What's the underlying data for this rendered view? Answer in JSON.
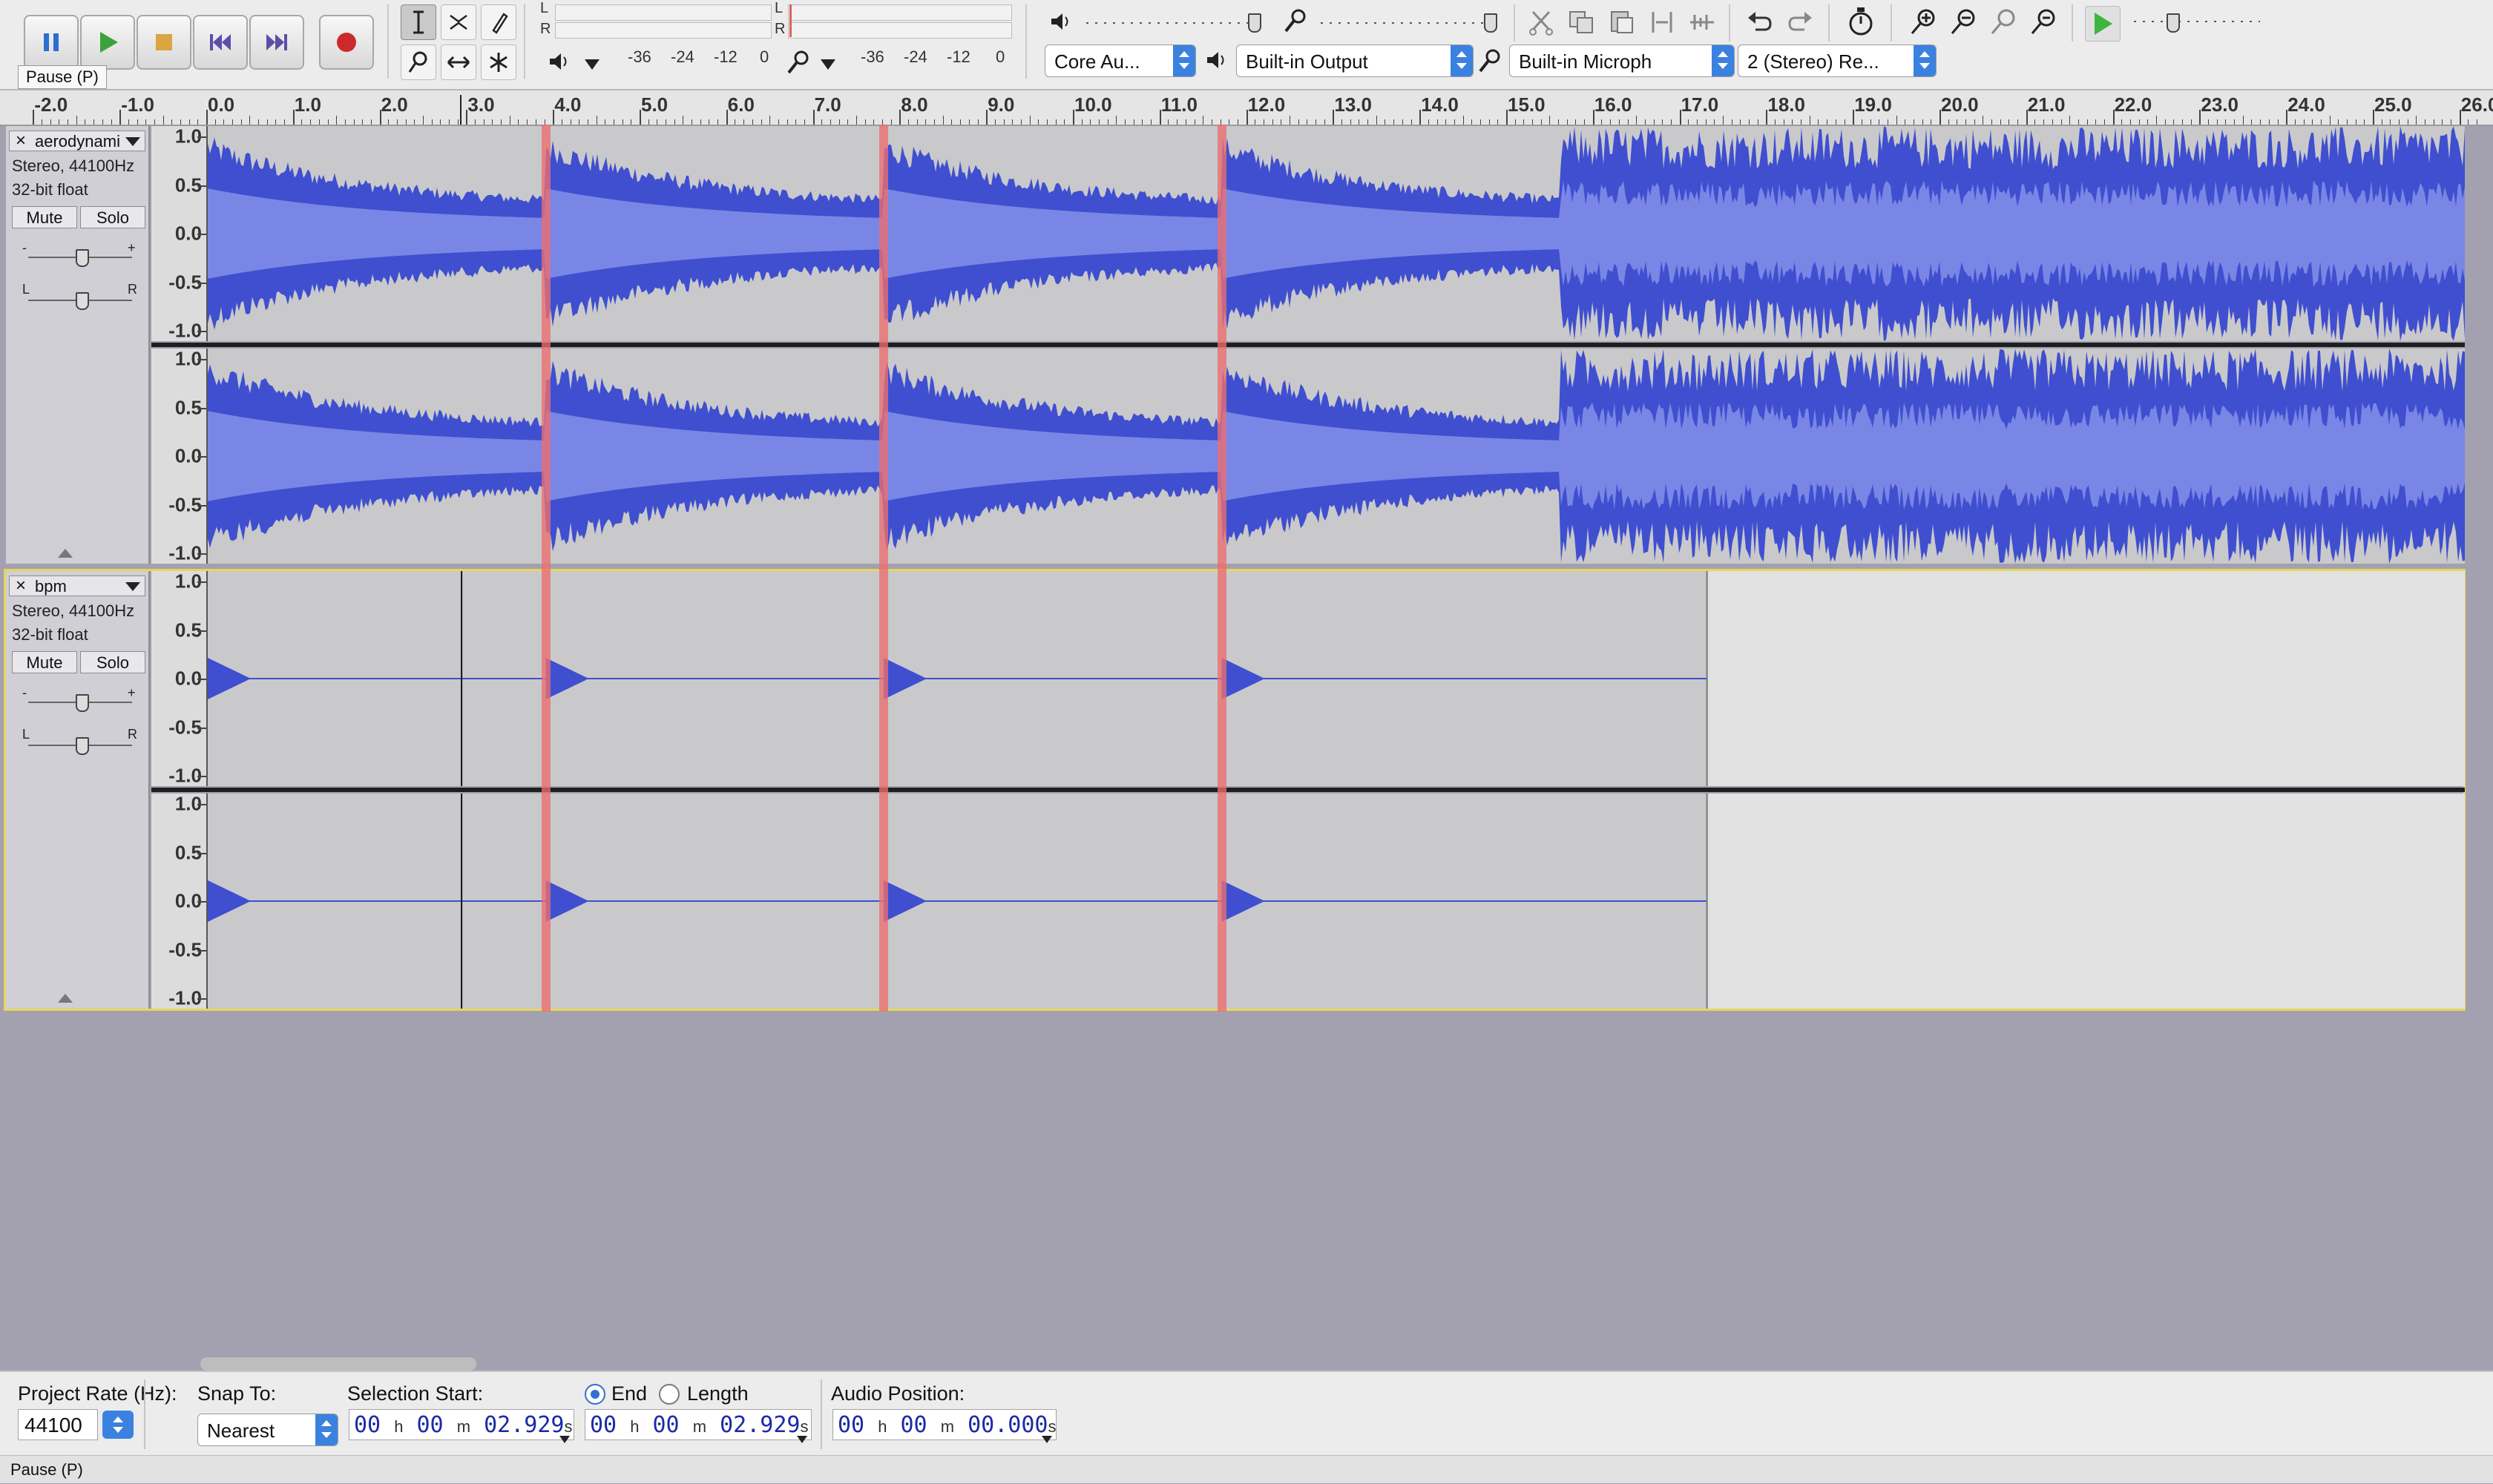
{
  "toolbar": {
    "transport": [
      {
        "name": "pause-button",
        "icon": "pause-icon"
      },
      {
        "name": "play-button",
        "icon": "play-icon"
      },
      {
        "name": "stop-button",
        "icon": "stop-icon"
      },
      {
        "name": "skip-start-button",
        "icon": "skip-to-start-icon"
      },
      {
        "name": "skip-end-button",
        "icon": "skip-to-end-icon"
      },
      {
        "name": "record-button",
        "icon": "record-icon"
      }
    ],
    "tooltip": "Pause (P)",
    "meter_scale": [
      "-36",
      "-24",
      "-12",
      "0"
    ],
    "meter_lr": [
      "L",
      "R"
    ],
    "devices": {
      "host": "Core Au...",
      "output": "Built-in Output",
      "input": "Built-in Microph",
      "channels": "2 (Stereo) Re..."
    }
  },
  "ruler": {
    "ticks": [
      "-2.0",
      "-1.0",
      "0.0",
      "1.0",
      "2.0",
      "3.0",
      "4.0",
      "5.0",
      "6.0",
      "7.0",
      "8.0",
      "9.0",
      "10.0",
      "11.0",
      "12.0",
      "13.0",
      "14.0",
      "15.0",
      "16.0",
      "17.0",
      "18.0",
      "19.0",
      "20.0",
      "21.0",
      "22.0",
      "23.0",
      "24.0",
      "25.0",
      "26.0"
    ]
  },
  "amplitude_labels": [
    "1.0",
    "0.5",
    "0.0",
    "-0.5",
    "-1.0"
  ],
  "tracks": [
    {
      "name": "aerodynami",
      "format": "Stereo, 44100Hz",
      "depth": "32-bit float",
      "mute": "Mute",
      "solo": "Solo",
      "gain_min": "-",
      "gain_max": "+",
      "pan_left": "L",
      "pan_right": "R"
    },
    {
      "name": "bpm",
      "format": "Stereo, 44100Hz",
      "depth": "32-bit float",
      "mute": "Mute",
      "solo": "Solo",
      "gain_min": "-",
      "gain_max": "+",
      "pan_left": "L",
      "pan_right": "R"
    }
  ],
  "selection_markers_seconds": [
    3.9,
    7.8,
    11.7
  ],
  "bottom": {
    "project_rate_label": "Project Rate (Hz):",
    "project_rate": "44100",
    "snap_label": "Snap To:",
    "snap_value": "Nearest",
    "selection_start_label": "Selection Start:",
    "end_label": "End",
    "length_label": "Length",
    "audio_position_label": "Audio Position:",
    "selection_start": {
      "h": "00",
      "m": "00",
      "s": "02.929"
    },
    "selection_end": {
      "h": "00",
      "m": "00",
      "s": "02.929"
    },
    "audio_position": {
      "h": "00",
      "m": "00",
      "s": "00.000"
    },
    "unit_h": "h",
    "unit_m": "m",
    "unit_s": "s"
  },
  "status": "Pause (P)",
  "colors": {
    "waveform": "#3f4fcf",
    "waveform_rms": "#7a86e6",
    "selection": "#ec6e6e",
    "track_bg": "#c9c9cb"
  }
}
